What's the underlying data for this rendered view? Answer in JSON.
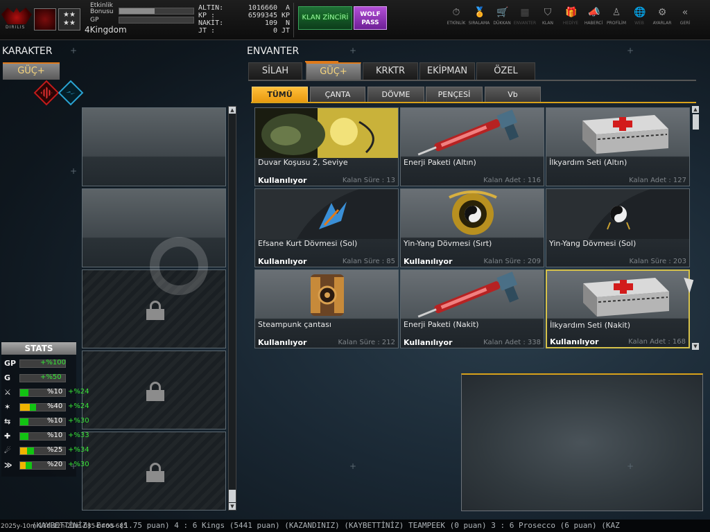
{
  "player": {
    "logo_text": "DIRILIS",
    "stars_badge": "★★\n★★",
    "event_bonus_label_1": "Etkinlik",
    "event_bonus_label_2": "Bonusu",
    "gp_label": "GP",
    "nickname": "4Kingdom",
    "event_bonus_progress": 0.48,
    "gp_progress": 0
  },
  "currency": [
    {
      "label": "ALTIN:",
      "value": "1016660",
      "unit": "A"
    },
    {
      "label": "KP :",
      "value": "6599345",
      "unit": "KP"
    },
    {
      "label": "NAKİT:",
      "value": "109",
      "unit": "N"
    },
    {
      "label": "JT :",
      "value": "0",
      "unit": "JT"
    }
  ],
  "promo": {
    "klan_chain": "KLAN ZİNCİRİ",
    "wolf_pass_1": "WOLF",
    "wolf_pass_2": "PASS"
  },
  "nav": [
    {
      "label": "ETKİNLİK",
      "icon": "stopwatch-icon",
      "glyph": "⏱",
      "enabled": true
    },
    {
      "label": "SIRALAMA",
      "icon": "medal-icon",
      "glyph": "🏅",
      "enabled": true
    },
    {
      "label": "DÜKKAN",
      "icon": "cart-icon",
      "glyph": "🛒",
      "enabled": true
    },
    {
      "label": "ENVANTER",
      "icon": "inventory-icon",
      "glyph": "▦",
      "enabled": false
    },
    {
      "label": "KLAN",
      "icon": "shield-icon",
      "glyph": "⛉",
      "enabled": true
    },
    {
      "label": "HEDİYE",
      "icon": "gift-icon",
      "glyph": "🎁",
      "enabled": false
    },
    {
      "label": "HABERCİ",
      "icon": "megaphone-icon",
      "glyph": "📣",
      "enabled": true
    },
    {
      "label": "PROFİLİM",
      "icon": "profile-icon",
      "glyph": "♙",
      "enabled": true
    },
    {
      "label": "WEB",
      "icon": "globe-icon",
      "glyph": "🌐",
      "enabled": false
    },
    {
      "label": "AYARLAR",
      "icon": "gear-icon",
      "glyph": "⚙",
      "enabled": true
    },
    {
      "label": "GERİ",
      "icon": "back-icon",
      "glyph": "«",
      "enabled": true
    }
  ],
  "character": {
    "title": "KARAKTER",
    "tab": "GÜÇ+",
    "slots": [
      {
        "locked": false
      },
      {
        "locked": false
      },
      {
        "locked": true
      },
      {
        "locked": true
      },
      {
        "locked": true
      }
    ]
  },
  "stats": {
    "title": "STATS",
    "rows": [
      {
        "icon": "GP",
        "icon_name": "gp-stat-icon",
        "bar1": 0,
        "bar2": 0,
        "value": "+%100",
        "bonus": "",
        "center": true
      },
      {
        "icon": "G",
        "icon_name": "gold-stat-icon",
        "bar1": 0,
        "bar2": 0,
        "value": "+%50",
        "bonus": "",
        "center": true
      },
      {
        "icon": "⚔",
        "icon_name": "attack-stat-icon",
        "bar1": 0.05,
        "bar2": 0.18,
        "value": "%10",
        "bonus": "+%24",
        "color": "#12c412"
      },
      {
        "icon": "✶",
        "icon_name": "burst-stat-icon",
        "bar1": 0.22,
        "bar2": 0.35,
        "value": "%40",
        "bonus": "+%24",
        "color": "#f0b400"
      },
      {
        "icon": "⇆",
        "icon_name": "speed-stat-icon",
        "bar1": 0.05,
        "bar2": 0.18,
        "value": "%10",
        "bonus": "+%30",
        "color": "#12c412"
      },
      {
        "icon": "✚",
        "icon_name": "health-stat-icon",
        "bar1": 0.05,
        "bar2": 0.18,
        "value": "%10",
        "bonus": "+%33",
        "color": "#12c412"
      },
      {
        "icon": "☄",
        "icon_name": "skill-stat-icon",
        "bar1": 0.15,
        "bar2": 0.3,
        "value": "%25",
        "bonus": "+%34",
        "color": "#f0b400"
      },
      {
        "icon": "≫",
        "icon_name": "dash-stat-icon",
        "bar1": 0.12,
        "bar2": 0.26,
        "value": "%20",
        "bonus": "+%30",
        "color": "#f0b400"
      }
    ]
  },
  "inventory": {
    "title": "ENVANTER",
    "tabs": [
      "SİLAH",
      "GÜÇ+",
      "KRKTR",
      "EKİPMAN",
      "ÖZEL"
    ],
    "active_tab": 1,
    "subtabs": [
      "TÜMÜ",
      "ÇANTA",
      "DÖVME",
      "PENÇESİ",
      "Vb"
    ],
    "active_subtab": 0,
    "items": [
      {
        "name": "Duvar Koşusu 2, Seviye",
        "status": "Kullanılıyor",
        "remaining": "Kalan Süre : 13",
        "art": "wolf-skill-art",
        "selected": false
      },
      {
        "name": "Enerji Paketi (Altın)",
        "status": "",
        "remaining": "Kalan Adet : 116",
        "art": "syringe-gun-art",
        "selected": false
      },
      {
        "name": "İlkyardım Seti (Altın)",
        "status": "",
        "remaining": "Kalan Adet : 127",
        "art": "medkit-art",
        "selected": false
      },
      {
        "name": "Efsane Kurt Dövmesi (Sol)",
        "status": "Kullanılıyor",
        "remaining": "Kalan Süre : 85",
        "art": "tattoo-wolf-art",
        "selected": false
      },
      {
        "name": "Yin-Yang Dövmesi (Sırt)",
        "status": "Kullanılıyor",
        "remaining": "Kalan Süre : 209",
        "art": "tattoo-dragon-art",
        "selected": false
      },
      {
        "name": "Yin-Yang Dövmesi (Sol)",
        "status": "",
        "remaining": "Kalan Süre : 203",
        "art": "tattoo-yinyang-art",
        "selected": false
      },
      {
        "name": "Steampunk çantası",
        "status": "Kullanılıyor",
        "remaining": "Kalan Süre : 212",
        "art": "steampunk-bag-art",
        "selected": false
      },
      {
        "name": "Enerji Paketi (Nakit)",
        "status": "Kullanılıyor",
        "remaining": "Kalan Adet : 338",
        "art": "syringe-gun-art",
        "selected": false
      },
      {
        "name": "İlkyardım Seti (Nakit)",
        "status": "Kullanılıyor",
        "remaining": "Kalan Adet : 168",
        "art": "medkit-art",
        "selected": true
      }
    ]
  },
  "ticker": "(KAYBETTİNİZ) Eros (1.75 puan) 4 : 6 Kings (5441 puan) (KAZANDINIZ)          (KAYBETTİNİZ) TEAMPEEK (0 puan) 3 : 6 Prosecco (6 puan) (KAZ",
  "build_id": "2025y-10m-13d-12h-21m-085-0460-685"
}
